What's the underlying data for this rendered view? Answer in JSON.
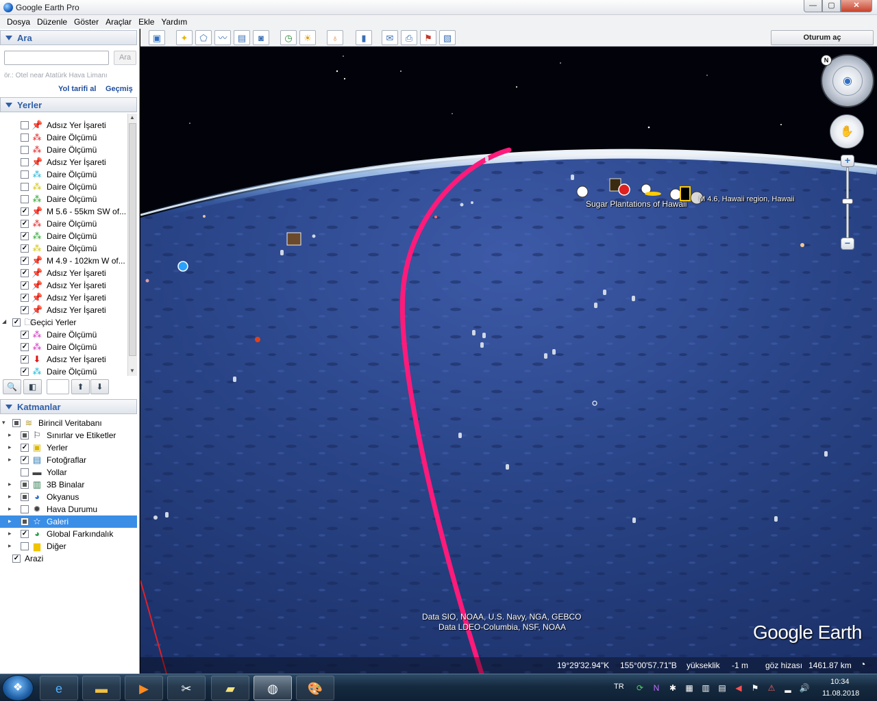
{
  "window": {
    "title": "Google Earth Pro",
    "min": "—",
    "max": "▢",
    "close": "✕"
  },
  "menu": [
    "Dosya",
    "Düzenle",
    "Göster",
    "Araçlar",
    "Ekle",
    "Yardım"
  ],
  "search": {
    "header": "Ara",
    "placeholder": "",
    "button": "Ara",
    "hint": "ör.: Otel near Atatürk Hava Limanı",
    "directions": "Yol tarifi al",
    "history": "Geçmiş"
  },
  "places": {
    "header": "Yerler",
    "items": [
      {
        "label": "Adsız Yer İşareti",
        "icon": "pushpin-yellow",
        "checked": false,
        "indent": 1
      },
      {
        "label": "Daire Ölçümü",
        "icon": "circle-red",
        "checked": false,
        "indent": 1
      },
      {
        "label": "Daire Ölçümü",
        "icon": "circle-red",
        "checked": false,
        "indent": 1
      },
      {
        "label": "Adsız Yer İşareti",
        "icon": "pushpin-yellow",
        "checked": false,
        "indent": 1
      },
      {
        "label": "Daire Ölçümü",
        "icon": "circle-cyan",
        "checked": false,
        "indent": 1
      },
      {
        "label": "Daire Ölçümü",
        "icon": "circle-yellow",
        "checked": false,
        "indent": 1
      },
      {
        "label": "Daire Ölçümü",
        "icon": "circle-green",
        "checked": false,
        "indent": 1
      },
      {
        "label": "M 5.6 - 55km SW of...",
        "icon": "pushpin-yellow",
        "checked": true,
        "indent": 1
      },
      {
        "label": "Daire Ölçümü",
        "icon": "circle-red",
        "checked": true,
        "indent": 1
      },
      {
        "label": "Daire Ölçümü",
        "icon": "circle-green",
        "checked": true,
        "indent": 1
      },
      {
        "label": "Daire Ölçümü",
        "icon": "circle-yellow",
        "checked": true,
        "indent": 1
      },
      {
        "label": "M 4.9 - 102km W of...",
        "icon": "pushpin-yellow",
        "checked": true,
        "indent": 1
      },
      {
        "label": "Adsız Yer İşareti",
        "icon": "pushpin-yellow",
        "checked": true,
        "indent": 1
      },
      {
        "label": "Adsız Yer İşareti",
        "icon": "pushpin-yellow",
        "checked": true,
        "indent": 1
      },
      {
        "label": "Adsız Yer İşareti",
        "icon": "pushpin-yellow",
        "checked": true,
        "indent": 1
      },
      {
        "label": "Adsız Yer İşareti",
        "icon": "pushpin-yellow",
        "checked": true,
        "indent": 1
      },
      {
        "label": "Geçici Yerler",
        "icon": "folder",
        "checked": true,
        "indent": 0,
        "expanded": true
      },
      {
        "label": "Daire Ölçümü",
        "icon": "circle-magenta",
        "checked": true,
        "indent": 1
      },
      {
        "label": "Daire Ölçümü",
        "icon": "circle-magenta",
        "checked": true,
        "indent": 1
      },
      {
        "label": "Adsız Yer İşareti",
        "icon": "arrow-red",
        "checked": true,
        "indent": 1
      },
      {
        "label": "Daire Ölçümü",
        "icon": "circle-cyan",
        "checked": true,
        "indent": 1
      }
    ]
  },
  "layers": {
    "header": "Katmanlar",
    "items": [
      {
        "label": "Birincil Veritabanı",
        "icon": "layers",
        "state": "partial",
        "indent": 0,
        "exp": "▾"
      },
      {
        "label": "Sınırlar ve Etiketler",
        "icon": "flag",
        "state": "partial",
        "indent": 1,
        "exp": "▸"
      },
      {
        "label": "Yerler",
        "icon": "square-yellow",
        "state": "checked",
        "indent": 1,
        "exp": "▸"
      },
      {
        "label": "Fotoğraflar",
        "icon": "photo",
        "state": "checked",
        "indent": 1,
        "exp": "▸"
      },
      {
        "label": "Yollar",
        "icon": "road",
        "state": "unchecked",
        "indent": 1,
        "exp": ""
      },
      {
        "label": "3B Binalar",
        "icon": "building",
        "state": "partial",
        "indent": 1,
        "exp": "▸"
      },
      {
        "label": "Okyanus",
        "icon": "globe-blue",
        "state": "partial",
        "indent": 1,
        "exp": "▸"
      },
      {
        "label": "Hava Durumu",
        "icon": "sun",
        "state": "unchecked",
        "indent": 1,
        "exp": "▸"
      },
      {
        "label": "Galeri",
        "icon": "star",
        "state": "partial",
        "indent": 1,
        "exp": "▸",
        "selected": true
      },
      {
        "label": "Global Farkındalık",
        "icon": "globe-green",
        "state": "checked",
        "indent": 1,
        "exp": "▸"
      },
      {
        "label": "Diğer",
        "icon": "folder-yellow",
        "state": "unchecked",
        "indent": 1,
        "exp": "▸"
      },
      {
        "label": "Arazi",
        "icon": "",
        "state": "checked",
        "indent": 0,
        "exp": ""
      }
    ]
  },
  "toolbar": {
    "signin": "Oturum aç"
  },
  "map": {
    "label_sugar": "Sugar Plantations of Hawaii",
    "label_quake": "M 4.6, Hawaii region, Hawaii",
    "attribution1": "Data SIO, NOAA, U.S. Navy, NGA, GEBCO",
    "attribution2": "Data LDEO-Columbia, NSF, NOAA",
    "logo": "Google Earth",
    "lat": "19°29'32.94\"K",
    "lon": "155°00'57.71\"B",
    "elev_label": "yükseklik",
    "elev_value": "-1 m",
    "eye_label": "göz hizası",
    "eye_value": "1461.87 km",
    "compass_n": "N"
  },
  "taskbar": {
    "lang": "TR",
    "time": "10:34",
    "date": "11.08.2018"
  },
  "colors": {
    "track": "#ff1a7a",
    "accent": "#2f5fa8",
    "selected": "#3a8ee6"
  }
}
